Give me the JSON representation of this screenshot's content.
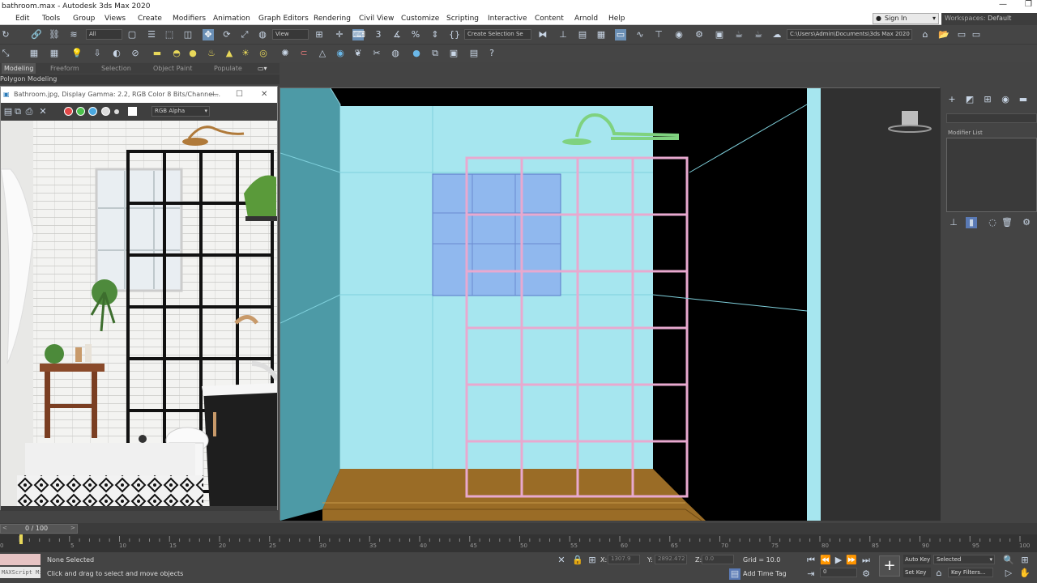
{
  "app": {
    "title": "bathroom.max - Autodesk 3ds Max 2020"
  },
  "menu": [
    "Edit",
    "Tools",
    "Group",
    "Views",
    "Create",
    "Modifiers",
    "Animation",
    "Graph Editors",
    "Rendering",
    "Civil View",
    "Customize",
    "Scripting",
    "Interactive",
    "Content",
    "Arnold",
    "Help"
  ],
  "account": {
    "sign_in": "Sign In",
    "workspaces_label": "Workspaces:",
    "workspace_value": "Default"
  },
  "toolbar": {
    "filter_value": "All",
    "ref_coord_value": "View",
    "selection_set_placeholder": "Create Selection Se",
    "project_path": "C:\\Users\\Admin\\Documents\\3ds Max 2020"
  },
  "ribbon": {
    "tabs": [
      "Modeling",
      "Freeform",
      "Selection",
      "Object Paint",
      "Populate"
    ],
    "panel_label": "Polygon Modeling"
  },
  "frame_buffer": {
    "title": "Bathroom.jpg, Display Gamma: 2.2, RGB Color 8 Bits/Channel...",
    "channel_value": "RGB Alpha"
  },
  "command_panel": {
    "modifier_list_label": "Modifier List"
  },
  "time": {
    "frame_counter": "0 / 100",
    "ticks": [
      "0",
      "5",
      "10",
      "15",
      "20",
      "25",
      "30",
      "35",
      "40",
      "45",
      "50",
      "55",
      "60",
      "65",
      "70",
      "75",
      "80",
      "85",
      "90",
      "95",
      "100"
    ]
  },
  "status": {
    "maxscript_label": "MAXScript Mini",
    "selection_text": "None Selected",
    "prompt_text": "Click and drag to select and move objects",
    "x_label": "X:",
    "x_value": "1307.9",
    "y_label": "Y:",
    "y_value": "2892.472",
    "z_label": "Z:",
    "z_value": "0.0",
    "grid_text": "Grid = 10.0",
    "add_time_tag": "Add Time Tag",
    "auto_key": "Auto Key",
    "set_key": "Set Key",
    "key_mode_value": "Selected",
    "key_filters": "Key Filters...",
    "frame_value": "0"
  },
  "colors": {
    "viewport_wall": "#a6e6ef",
    "grid_frame": "#e8a9cf",
    "shower_head": "#7fd27f",
    "floor": "#9a6c26"
  }
}
